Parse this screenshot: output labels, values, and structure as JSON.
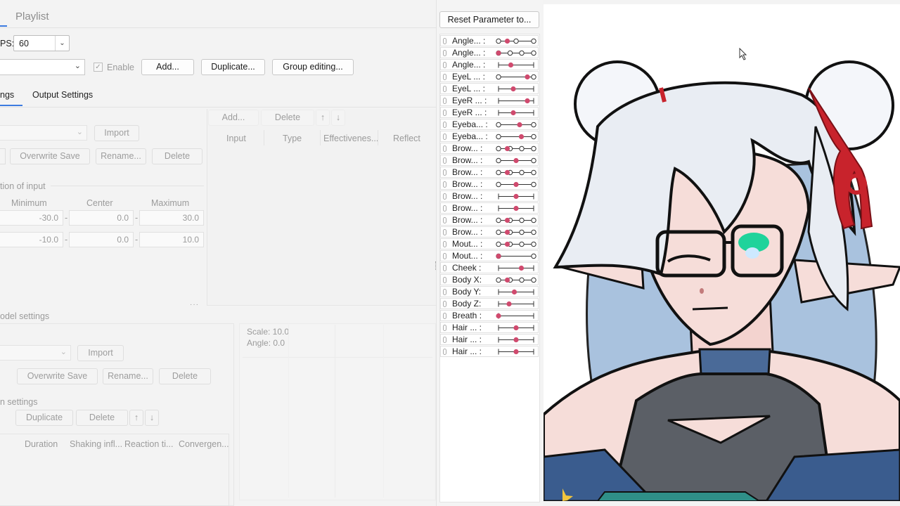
{
  "playlist_title": "Playlist",
  "fps": {
    "label": "PS:",
    "value": "60"
  },
  "toolbar": {
    "enable_label": "Enable",
    "add_label": "Add...",
    "duplicate_label": "Duplicate...",
    "group_editing_label": "Group editing..."
  },
  "tabs": {
    "settings_label": "ngs",
    "output_label": "Output Settings"
  },
  "left_panel": {
    "import_label": "Import",
    "overwrite_label": "Overwrite Save",
    "rename_label": "Rename...",
    "delete_label": "Delete",
    "section_input": "tion of input",
    "col_min": "Minimum",
    "col_center": "Center",
    "col_max": "Maximum",
    "rows": [
      {
        "min": "-30.0",
        "center": "0.0",
        "max": "30.0"
      },
      {
        "min": "-10.0",
        "center": "0.0",
        "max": "10.0"
      }
    ],
    "section_model": "odel settings",
    "import2_label": "Import",
    "overwrite2_label": "Overwrite Save",
    "rename2_label": "Rename...",
    "delete2_label": "Delete",
    "section_reaction": "n settings",
    "duplicate3_label": "Duplicate",
    "delete3_label": "Delete",
    "up_arrow": "↑",
    "down_arrow": "↓",
    "cols3": [
      "Duration",
      "Shaking infl...",
      "Reaction ti...",
      "Convergen..."
    ]
  },
  "input_panel": {
    "add_label": "Add...",
    "delete_label": "Delete",
    "up_arrow": "↑",
    "down_arrow": "↓",
    "cols": [
      "Input",
      "Type",
      "Effectivenes...",
      "Reflect"
    ]
  },
  "scale_panel": {
    "scale": "Scale: 10.0",
    "angle": "Angle: 0.0"
  },
  "reset_button": "Reset Parameter to...",
  "params": [
    {
      "name": "Angle... :",
      "pos": 0.25,
      "style": "o3"
    },
    {
      "name": "Angle... :",
      "pos": 0.0,
      "style": "o4"
    },
    {
      "name": "Angle... :",
      "pos": 0.35,
      "style": "line"
    },
    {
      "name": "EyeL ... :",
      "pos": 0.82,
      "style": "o2r"
    },
    {
      "name": "EyeL ... :",
      "pos": 0.42,
      "style": "line"
    },
    {
      "name": "EyeR ... :",
      "pos": 0.82,
      "style": "line"
    },
    {
      "name": "EyeR ... :",
      "pos": 0.42,
      "style": "line"
    },
    {
      "name": "Eyeba... :",
      "pos": 0.6,
      "style": "o2m"
    },
    {
      "name": "Eyeba... :",
      "pos": 0.65,
      "style": "o2m"
    },
    {
      "name": "Brow... :",
      "pos": 0.25,
      "style": "o4"
    },
    {
      "name": "Brow... :",
      "pos": 0.5,
      "style": "o2"
    },
    {
      "name": "Brow... :",
      "pos": 0.25,
      "style": "o4"
    },
    {
      "name": "Brow... :",
      "pos": 0.5,
      "style": "o2"
    },
    {
      "name": "Brow... :",
      "pos": 0.5,
      "style": "line"
    },
    {
      "name": "Brow... :",
      "pos": 0.5,
      "style": "line"
    },
    {
      "name": "Brow... :",
      "pos": 0.25,
      "style": "o4"
    },
    {
      "name": "Brow... :",
      "pos": 0.25,
      "style": "o4"
    },
    {
      "name": "Mout... :",
      "pos": 0.25,
      "style": "o4"
    },
    {
      "name": "Mout... :",
      "pos": 0.0,
      "style": "o2"
    },
    {
      "name": "Cheek :",
      "pos": 0.65,
      "style": "line"
    },
    {
      "name": "Body X:",
      "pos": 0.25,
      "style": "o4"
    },
    {
      "name": "Body Y:",
      "pos": 0.45,
      "style": "line"
    },
    {
      "name": "Body Z:",
      "pos": 0.3,
      "style": "line"
    },
    {
      "name": "Breath :",
      "pos": 0.0,
      "style": "line"
    },
    {
      "name": "Hair ... :",
      "pos": 0.5,
      "style": "line"
    },
    {
      "name": "Hair ... :",
      "pos": 0.5,
      "style": "line"
    },
    {
      "name": "Hair ... :",
      "pos": 0.5,
      "style": "line"
    }
  ],
  "colors": {
    "accent": "#d04a6e",
    "hair": "#e9edf3",
    "hair_shadow": "#9bb6d4",
    "ribbon": "#c8232c",
    "skin": "#f6ddd9",
    "eye": "#1fd39b"
  }
}
